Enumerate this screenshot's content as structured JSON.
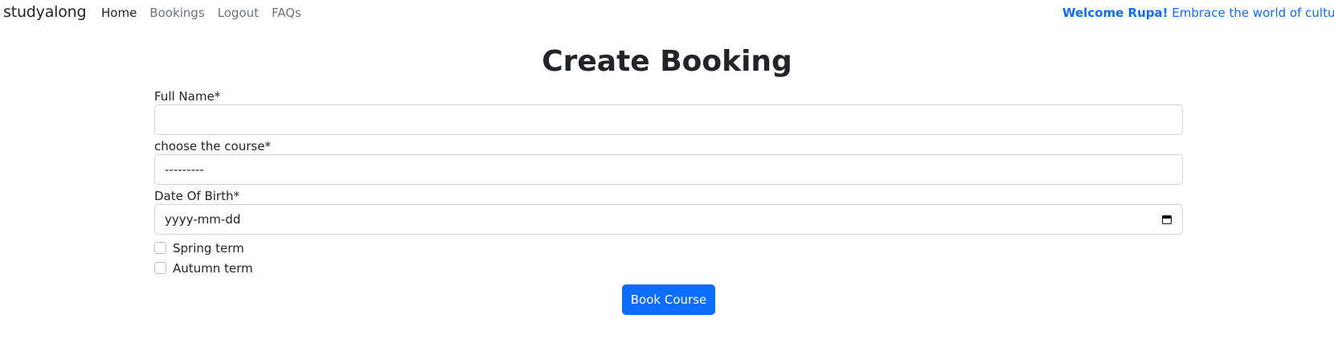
{
  "navbar": {
    "brand": "studyalong",
    "links": [
      {
        "label": "Home",
        "active": true
      },
      {
        "label": "Bookings",
        "active": false
      },
      {
        "label": "Logout",
        "active": false
      },
      {
        "label": "FAQs",
        "active": false
      }
    ],
    "welcome_name": "Welcome Rupa!",
    "welcome_message": "Embrace the world of culture"
  },
  "page": {
    "title": "Create Booking"
  },
  "form": {
    "full_name": {
      "label": "Full Name*",
      "value": ""
    },
    "course": {
      "label": "choose the course*",
      "selected": "---------"
    },
    "dob": {
      "label": "Date Of Birth*",
      "placeholder": "yyyy-mm-dd"
    },
    "terms": [
      {
        "label": "Spring term",
        "checked": false
      },
      {
        "label": "Autumn term",
        "checked": false
      }
    ],
    "submit_label": "Book Course"
  },
  "colors": {
    "primary": "#0d6efd",
    "text": "#212529",
    "muted": "#6c757d",
    "border": "#ced4da"
  }
}
